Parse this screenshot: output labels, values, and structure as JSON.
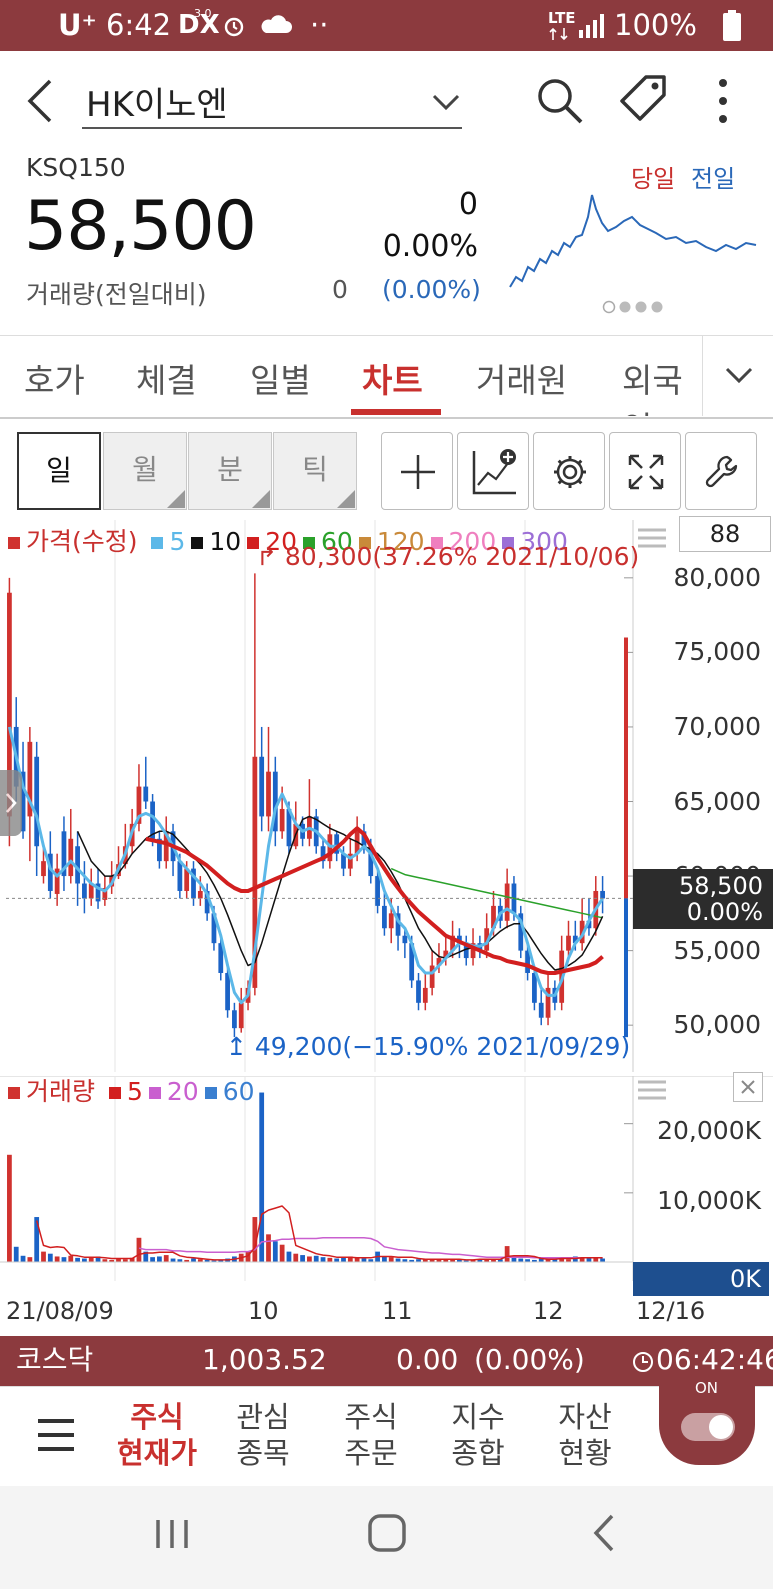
{
  "status_bar": {
    "carrier": "U⁺",
    "time": "6:42",
    "dx_label": "DX",
    "dx_badge": "3.0",
    "dots": "··",
    "network": "LTE",
    "battery": "100%"
  },
  "app_bar": {
    "stock_name": "HK이노엔"
  },
  "quote": {
    "market_code": "KSQ150",
    "price": "58,500",
    "change": "0",
    "change_rate": "0.00%",
    "volume_label": "거래량(전일대비)",
    "volume_value": "0",
    "volume_rate": "(0.00%)",
    "legend_today": "당일",
    "legend_prev": "전일"
  },
  "tabs": {
    "items": [
      "호가",
      "체결",
      "일별",
      "차트",
      "거래원",
      "외국인"
    ],
    "active": "차트"
  },
  "period": {
    "items": [
      "일",
      "월",
      "분",
      "틱"
    ],
    "active": "일"
  },
  "price_panel": {
    "legend_main": "가격(수정)",
    "ma_items": [
      {
        "label": "5",
        "color": "#5cb8e8"
      },
      {
        "label": "10",
        "color": "#111111"
      },
      {
        "label": "20",
        "color": "#d21f1f"
      },
      {
        "label": "60",
        "color": "#2aa12a"
      },
      {
        "label": "120",
        "color": "#c98a3a"
      },
      {
        "label": "200",
        "color": "#ef7fbf"
      },
      {
        "label": "300",
        "color": "#9c6fd6"
      }
    ],
    "count_box": "88",
    "high_annotation": "80,300(37.26% 2021/10/06)",
    "low_annotation": "49,200(−15.90% 2021/09/29)",
    "y_labels": [
      "80,000",
      "75,000",
      "70,000",
      "65,000",
      "60,000",
      "55,000",
      "50,000"
    ],
    "current_price": "58,500",
    "current_rate": "0.00%"
  },
  "volume_panel": {
    "legend_main": "거래량",
    "ma_items": [
      {
        "label": "5",
        "color": "#d21f1f"
      },
      {
        "label": "20",
        "color": "#c95fcf"
      },
      {
        "label": "60",
        "color": "#3a7fd0"
      }
    ],
    "y_labels": [
      "20,000K",
      "10,000K"
    ],
    "current_volume": "0K"
  },
  "x_axis": {
    "labels": [
      "21/08/09",
      "10",
      "11",
      "12"
    ],
    "right_label": "12/16"
  },
  "index_bar": {
    "name": "코스닥",
    "value": "1,003.52",
    "change": "0.00",
    "rate": "(0.00%)",
    "time": "06:42:46"
  },
  "bottom_nav": {
    "items": [
      {
        "line1": "주식",
        "line2": "현재가",
        "active": true
      },
      {
        "line1": "관심",
        "line2": "종목",
        "active": false
      },
      {
        "line1": "주식",
        "line2": "주문",
        "active": false
      },
      {
        "line1": "지수",
        "line2": "종합",
        "active": false
      },
      {
        "line1": "자산",
        "line2": "현황",
        "active": false
      }
    ],
    "toggle_label": "ON"
  },
  "colors": {
    "brand": "#8c3a3e",
    "up": "#d0322f",
    "down": "#1b63c6",
    "active_tab": "#c8302e"
  },
  "chart_data": {
    "type": "candlestick",
    "price_y_range": [
      48000,
      82000
    ],
    "price_ticks": [
      80000,
      75000,
      70000,
      65000,
      60000,
      55000,
      50000
    ],
    "high": 80300,
    "low": 49200,
    "last": 58500,
    "candles": [
      {
        "o": 64000,
        "c": 79000,
        "h": 80000,
        "l": 62000
      },
      {
        "o": 70000,
        "c": 66000,
        "h": 72000,
        "l": 65000
      },
      {
        "o": 67000,
        "c": 63000,
        "h": 69000,
        "l": 62500
      },
      {
        "o": 64000,
        "c": 69000,
        "h": 70000,
        "l": 61000
      },
      {
        "o": 68000,
        "c": 62000,
        "h": 69000,
        "l": 60000
      },
      {
        "o": 60000,
        "c": 61000,
        "h": 62000,
        "l": 59500
      },
      {
        "o": 61500,
        "c": 59000,
        "h": 63000,
        "l": 58500
      },
      {
        "o": 58800,
        "c": 60500,
        "h": 61500,
        "l": 58000
      },
      {
        "o": 63000,
        "c": 60000,
        "h": 64000,
        "l": 59000
      },
      {
        "o": 60000,
        "c": 62500,
        "h": 64500,
        "l": 59500
      },
      {
        "o": 62000,
        "c": 59500,
        "h": 63000,
        "l": 58000
      },
      {
        "o": 59500,
        "c": 58500,
        "h": 61000,
        "l": 57500
      },
      {
        "o": 58500,
        "c": 59500,
        "h": 60500,
        "l": 58000
      },
      {
        "o": 59500,
        "c": 58300,
        "h": 60500,
        "l": 57800
      },
      {
        "o": 58400,
        "c": 59200,
        "h": 60000,
        "l": 58000
      },
      {
        "o": 59300,
        "c": 60000,
        "h": 61000,
        "l": 58800
      },
      {
        "o": 60000,
        "c": 60800,
        "h": 62000,
        "l": 59800
      },
      {
        "o": 60800,
        "c": 62000,
        "h": 63500,
        "l": 60500
      },
      {
        "o": 62000,
        "c": 63500,
        "h": 64500,
        "l": 61500
      },
      {
        "o": 63500,
        "c": 66000,
        "h": 67500,
        "l": 63000
      },
      {
        "o": 66000,
        "c": 65000,
        "h": 68000,
        "l": 64500
      },
      {
        "o": 65000,
        "c": 62500,
        "h": 65500,
        "l": 62000
      },
      {
        "o": 62500,
        "c": 61000,
        "h": 63000,
        "l": 60500
      },
      {
        "o": 61000,
        "c": 63000,
        "h": 64000,
        "l": 60500
      },
      {
        "o": 63000,
        "c": 61000,
        "h": 63500,
        "l": 60000
      },
      {
        "o": 61000,
        "c": 59000,
        "h": 61500,
        "l": 58500
      },
      {
        "o": 59000,
        "c": 60500,
        "h": 61000,
        "l": 58500
      },
      {
        "o": 60500,
        "c": 58500,
        "h": 61000,
        "l": 58000
      },
      {
        "o": 58500,
        "c": 59000,
        "h": 60000,
        "l": 58000
      },
      {
        "o": 59000,
        "c": 57500,
        "h": 59500,
        "l": 57000
      },
      {
        "o": 57500,
        "c": 55500,
        "h": 58000,
        "l": 55000
      },
      {
        "o": 55500,
        "c": 53500,
        "h": 56000,
        "l": 53000
      },
      {
        "o": 53500,
        "c": 51000,
        "h": 54000,
        "l": 50500
      },
      {
        "o": 51000,
        "c": 49800,
        "h": 51500,
        "l": 49200
      },
      {
        "o": 49800,
        "c": 51500,
        "h": 52500,
        "l": 49500
      },
      {
        "o": 51500,
        "c": 52500,
        "h": 53000,
        "l": 51000
      },
      {
        "o": 52500,
        "c": 68000,
        "h": 80300,
        "l": 52000
      },
      {
        "o": 68000,
        "c": 64000,
        "h": 70000,
        "l": 63000
      },
      {
        "o": 64000,
        "c": 67000,
        "h": 70000,
        "l": 63000
      },
      {
        "o": 67000,
        "c": 63000,
        "h": 68000,
        "l": 62000
      },
      {
        "o": 63000,
        "c": 64500,
        "h": 66000,
        "l": 62500
      },
      {
        "o": 64500,
        "c": 62000,
        "h": 65000,
        "l": 61500
      },
      {
        "o": 62000,
        "c": 63500,
        "h": 65000,
        "l": 61800
      },
      {
        "o": 63500,
        "c": 62500,
        "h": 64000,
        "l": 62000
      },
      {
        "o": 62500,
        "c": 64000,
        "h": 66500,
        "l": 62000
      },
      {
        "o": 64000,
        "c": 62000,
        "h": 64500,
        "l": 61500
      },
      {
        "o": 62000,
        "c": 61000,
        "h": 62500,
        "l": 60500
      },
      {
        "o": 61000,
        "c": 62800,
        "h": 63500,
        "l": 60500
      },
      {
        "o": 62800,
        "c": 61500,
        "h": 63000,
        "l": 61000
      },
      {
        "o": 61500,
        "c": 60500,
        "h": 62000,
        "l": 60000
      },
      {
        "o": 60500,
        "c": 61500,
        "h": 62500,
        "l": 60000
      },
      {
        "o": 61500,
        "c": 63000,
        "h": 64000,
        "l": 61000
      },
      {
        "o": 63000,
        "c": 62000,
        "h": 63500,
        "l": 61500
      },
      {
        "o": 62000,
        "c": 60000,
        "h": 62500,
        "l": 59500
      },
      {
        "o": 60000,
        "c": 58000,
        "h": 60500,
        "l": 57500
      },
      {
        "o": 58000,
        "c": 56500,
        "h": 59000,
        "l": 56000
      },
      {
        "o": 56500,
        "c": 57500,
        "h": 58500,
        "l": 55500
      },
      {
        "o": 57500,
        "c": 56000,
        "h": 58000,
        "l": 55000
      },
      {
        "o": 56000,
        "c": 55500,
        "h": 56500,
        "l": 54500
      },
      {
        "o": 55500,
        "c": 53000,
        "h": 56000,
        "l": 52500
      },
      {
        "o": 53000,
        "c": 51500,
        "h": 53500,
        "l": 51000
      },
      {
        "o": 51500,
        "c": 52500,
        "h": 53500,
        "l": 51000
      },
      {
        "o": 52500,
        "c": 54000,
        "h": 55000,
        "l": 52000
      },
      {
        "o": 54000,
        "c": 54500,
        "h": 55500,
        "l": 53500
      },
      {
        "o": 54500,
        "c": 55000,
        "h": 56000,
        "l": 54000
      },
      {
        "o": 55000,
        "c": 56000,
        "h": 57000,
        "l": 54500
      },
      {
        "o": 56000,
        "c": 55500,
        "h": 56500,
        "l": 54500
      },
      {
        "o": 55500,
        "c": 54500,
        "h": 56000,
        "l": 54000
      },
      {
        "o": 54500,
        "c": 55500,
        "h": 56500,
        "l": 54000
      },
      {
        "o": 55500,
        "c": 55000,
        "h": 56000,
        "l": 54500
      },
      {
        "o": 55000,
        "c": 56500,
        "h": 57500,
        "l": 54500
      },
      {
        "o": 56500,
        "c": 58000,
        "h": 59000,
        "l": 56000
      },
      {
        "o": 58000,
        "c": 57000,
        "h": 58500,
        "l": 56500
      },
      {
        "o": 57000,
        "c": 59500,
        "h": 60500,
        "l": 56500
      },
      {
        "o": 59500,
        "c": 57500,
        "h": 60000,
        "l": 57000
      },
      {
        "o": 57500,
        "c": 55000,
        "h": 58000,
        "l": 54500
      },
      {
        "o": 55000,
        "c": 53500,
        "h": 55500,
        "l": 53000
      },
      {
        "o": 53500,
        "c": 51500,
        "h": 54000,
        "l": 51000
      },
      {
        "o": 51500,
        "c": 50500,
        "h": 52500,
        "l": 50000
      },
      {
        "o": 50500,
        "c": 52500,
        "h": 53500,
        "l": 50000
      },
      {
        "o": 52500,
        "c": 51500,
        "h": 53000,
        "l": 51000
      },
      {
        "o": 51500,
        "c": 55000,
        "h": 56000,
        "l": 51000
      },
      {
        "o": 55000,
        "c": 56000,
        "h": 57000,
        "l": 54500
      },
      {
        "o": 56000,
        "c": 55500,
        "h": 57000,
        "l": 55000
      },
      {
        "o": 55500,
        "c": 57000,
        "h": 58500,
        "l": 55000
      },
      {
        "o": 57000,
        "c": 56500,
        "h": 58500,
        "l": 56000
      },
      {
        "o": 56500,
        "c": 59000,
        "h": 60000,
        "l": 56000
      },
      {
        "o": 59000,
        "c": 58500,
        "h": 60000,
        "l": 57500
      }
    ],
    "ma5": [
      70000,
      68000,
      66000,
      65000,
      64000,
      62000,
      60500,
      60000,
      60500,
      61000,
      60500,
      60000,
      59500,
      59200,
      59000,
      59500,
      60500,
      61500,
      63000,
      64000,
      64200,
      64000,
      63500,
      62800,
      62000,
      61000,
      60500,
      60000,
      59500,
      58800,
      57500,
      56000,
      54000,
      52200,
      51500,
      52000,
      55000,
      58500,
      62000,
      64500,
      65500,
      64500,
      63500,
      63000,
      63200,
      63000,
      62500,
      62000,
      62000,
      61500,
      61200,
      61500,
      62000,
      61500,
      60500,
      59000,
      58000,
      57000,
      56500,
      55500,
      54000,
      53500,
      53500,
      54000,
      54500,
      55000,
      55500,
      55500,
      55300,
      55300,
      55500,
      56500,
      57500,
      57800,
      57500,
      57000,
      55500,
      53800,
      52500,
      52000,
      52000,
      53000,
      54500,
      55500,
      56000,
      57000,
      57800,
      58500
    ],
    "ma10": [
      null,
      null,
      null,
      null,
      null,
      null,
      null,
      null,
      null,
      null,
      63000,
      62000,
      61000,
      60500,
      60000,
      60000,
      60200,
      60800,
      61500,
      62000,
      62500,
      62800,
      63000,
      63000,
      62800,
      62300,
      61800,
      61300,
      60800,
      60200,
      59400,
      58500,
      57400,
      56200,
      55000,
      54000,
      54200,
      55500,
      57000,
      58500,
      60000,
      61500,
      62800,
      63800,
      64000,
      63800,
      63500,
      63200,
      63000,
      62800,
      62500,
      62300,
      62000,
      61800,
      61500,
      61000,
      60300,
      59500,
      58500,
      57500,
      56500,
      55800,
      55000,
      54600,
      54500,
      54700,
      54900,
      55100,
      55200,
      55300,
      55500,
      55900,
      56300,
      56600,
      56800,
      56800,
      56200,
      55500,
      54800,
      54200,
      53700,
      53800,
      54000,
      54300,
      54700,
      55500,
      56300,
      57300
    ],
    "ma20": [
      null,
      null,
      null,
      null,
      null,
      null,
      null,
      null,
      null,
      null,
      null,
      null,
      null,
      null,
      null,
      null,
      null,
      null,
      null,
      null,
      62500,
      62400,
      62300,
      62200,
      62000,
      61800,
      61600,
      61300,
      61000,
      60700,
      60300,
      59900,
      59500,
      59200,
      59000,
      59000,
      59200,
      59400,
      59600,
      59800,
      60000,
      60200,
      60400,
      60600,
      60800,
      61000,
      61200,
      61500,
      61900,
      62300,
      62800,
      63200,
      62800,
      62000,
      61200,
      60500,
      59800,
      59200,
      58600,
      58100,
      57600,
      57200,
      56800,
      56400,
      56000,
      55800,
      55600,
      55400,
      55200,
      55000,
      54800,
      54600,
      54500,
      54300,
      54200,
      54100,
      54000,
      53800,
      53600,
      53500,
      53500,
      53600,
      53700,
      53800,
      53900,
      54000,
      54200,
      54600
    ],
    "ma60": [
      null,
      null,
      null,
      null,
      null,
      null,
      null,
      null,
      null,
      null,
      null,
      null,
      null,
      null,
      null,
      null,
      null,
      null,
      null,
      null,
      null,
      null,
      null,
      null,
      null,
      null,
      null,
      null,
      null,
      null,
      null,
      null,
      null,
      null,
      null,
      null,
      null,
      null,
      null,
      null,
      null,
      null,
      null,
      null,
      null,
      null,
      null,
      null,
      null,
      null,
      null,
      null,
      null,
      null,
      null,
      null,
      60500,
      60300,
      60100,
      60000,
      59900,
      59800,
      59700,
      59600,
      59500,
      59400,
      59300,
      59200,
      59100,
      59000,
      58900,
      58800,
      58700,
      58600,
      58500,
      58400,
      58300,
      58200,
      58100,
      58000,
      57900,
      57800,
      57700,
      57600,
      57500,
      57400,
      57300,
      57200
    ],
    "volume_y_range": [
      0,
      24000
    ],
    "volume_ticks": [
      20000,
      10000
    ],
    "volume_unit": "K",
    "volumes": [
      15500,
      2200,
      900,
      700,
      6500,
      1500,
      1200,
      800,
      700,
      900,
      600,
      500,
      700,
      800,
      400,
      300,
      500,
      400,
      600,
      3500,
      1500,
      700,
      800,
      1000,
      500,
      400,
      300,
      500,
      400,
      300,
      200,
      300,
      500,
      800,
      1200,
      1500,
      6500,
      24500,
      4000,
      3000,
      2500,
      1500,
      1200,
      1000,
      800,
      900,
      700,
      600,
      500,
      700,
      800,
      600,
      500,
      400,
      1500,
      800,
      700,
      500,
      400,
      300,
      400,
      500,
      400,
      300,
      500,
      400,
      300,
      200,
      300,
      400,
      500,
      300,
      400,
      2300,
      800,
      500,
      400,
      300,
      500,
      400,
      600,
      500,
      400,
      800,
      600,
      700,
      600,
      500
    ],
    "vol_ma5": [
      null,
      null,
      null,
      null,
      6000,
      2400,
      2100,
      2200,
      2100,
      1000,
      900,
      700,
      700,
      700,
      600,
      500,
      500,
      500,
      500,
      1100,
      1300,
      1300,
      1400,
      1400,
      1400,
      900,
      700,
      600,
      500,
      400,
      300,
      300,
      300,
      400,
      600,
      900,
      2100,
      6900,
      7500,
      7800,
      8100,
      7100,
      2400,
      2000,
      1600,
      1200,
      1000,
      900,
      700,
      700,
      700,
      600,
      600,
      600,
      800,
      800,
      800,
      700,
      700,
      700,
      500,
      400,
      400,
      400,
      400,
      400,
      400,
      300,
      300,
      400,
      400,
      400,
      400,
      800,
      900,
      900,
      900,
      800,
      500,
      400,
      400,
      500,
      500,
      500,
      600,
      600,
      600,
      600
    ],
    "vol_ma20": [
      null,
      null,
      null,
      null,
      null,
      null,
      null,
      null,
      null,
      null,
      null,
      null,
      null,
      null,
      null,
      null,
      null,
      null,
      null,
      2000,
      1800,
      1800,
      1800,
      1800,
      1600,
      1600,
      1500,
      1500,
      1500,
      1400,
      1400,
      1400,
      1400,
      1400,
      1500,
      1500,
      1800,
      2900,
      3000,
      3100,
      3300,
      3300,
      3400,
      3400,
      3400,
      3400,
      3500,
      3500,
      3500,
      3500,
      3500,
      3500,
      3500,
      3400,
      3000,
      2200,
      2000,
      1800,
      1700,
      1600,
      1500,
      1400,
      1300,
      1300,
      1200,
      1100,
      1100,
      1000,
      900,
      800,
      700,
      700,
      700,
      700,
      700,
      700,
      700,
      600,
      600,
      600,
      600,
      600,
      600,
      600,
      600,
      600,
      600,
      600
    ]
  }
}
